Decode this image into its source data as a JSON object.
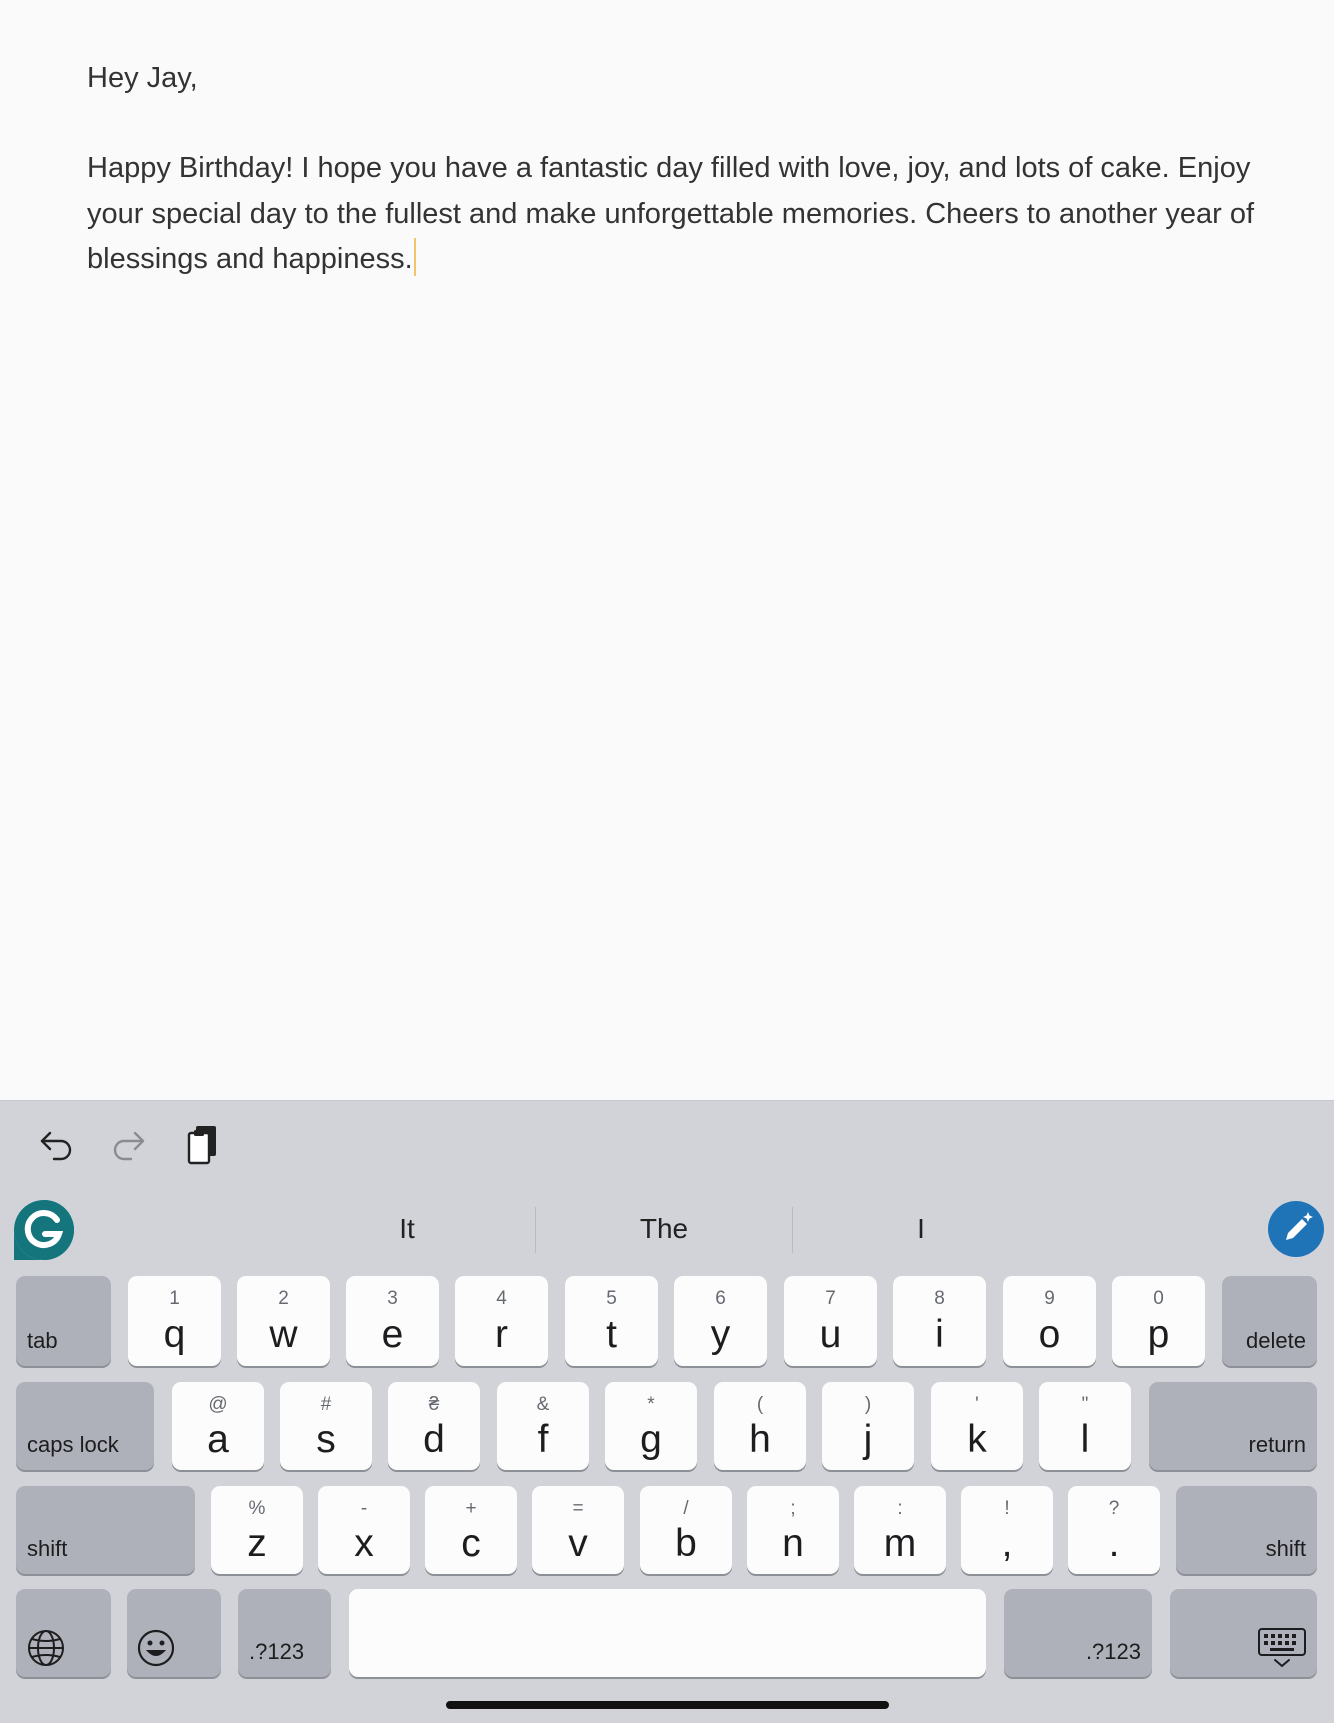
{
  "document": {
    "greeting": "Hey Jay,",
    "body": "Happy Birthday! I hope you have a fantastic day filled with love, joy, and lots of cake. Enjoy your special day to the fullest and make unforgettable memories. Cheers to another year of blessings and happiness."
  },
  "toolbar": {
    "icons": [
      "undo-icon",
      "redo-icon",
      "clipboard-icon"
    ]
  },
  "predictions": [
    "It",
    "The",
    "I"
  ],
  "extensions": {
    "left": "grammarly-icon",
    "right": "ai-writing-icon"
  },
  "keyboard": {
    "row1": {
      "left": "tab",
      "keys": [
        {
          "p": "q",
          "s": "1"
        },
        {
          "p": "w",
          "s": "2"
        },
        {
          "p": "e",
          "s": "3"
        },
        {
          "p": "r",
          "s": "4"
        },
        {
          "p": "t",
          "s": "5"
        },
        {
          "p": "y",
          "s": "6"
        },
        {
          "p": "u",
          "s": "7"
        },
        {
          "p": "i",
          "s": "8"
        },
        {
          "p": "o",
          "s": "9"
        },
        {
          "p": "p",
          "s": "0"
        }
      ],
      "right": "delete"
    },
    "row2": {
      "left": "caps lock",
      "keys": [
        {
          "p": "a",
          "s": "@"
        },
        {
          "p": "s",
          "s": "#"
        },
        {
          "p": "d",
          "s": "₴"
        },
        {
          "p": "f",
          "s": "&"
        },
        {
          "p": "g",
          "s": "*"
        },
        {
          "p": "h",
          "s": "("
        },
        {
          "p": "j",
          "s": ")"
        },
        {
          "p": "k",
          "s": "'"
        },
        {
          "p": "l",
          "s": "\""
        }
      ],
      "right": "return"
    },
    "row3": {
      "left": "shift",
      "keys": [
        {
          "p": "z",
          "s": "%"
        },
        {
          "p": "x",
          "s": "-"
        },
        {
          "p": "c",
          "s": "+"
        },
        {
          "p": "v",
          "s": "="
        },
        {
          "p": "b",
          "s": "/"
        },
        {
          "p": "n",
          "s": ";"
        },
        {
          "p": "m",
          "s": ":"
        },
        {
          "p": ",",
          "s": "!"
        },
        {
          "p": ".",
          "s": "?"
        }
      ],
      "right": "shift"
    },
    "row4": {
      "globe_icon": "globe-icon",
      "emoji_icon": "emoji-icon",
      "numbers_left": ".?123",
      "space": "",
      "numbers_right": ".?123",
      "dismiss_icon": "keyboard-dismiss-icon"
    }
  }
}
